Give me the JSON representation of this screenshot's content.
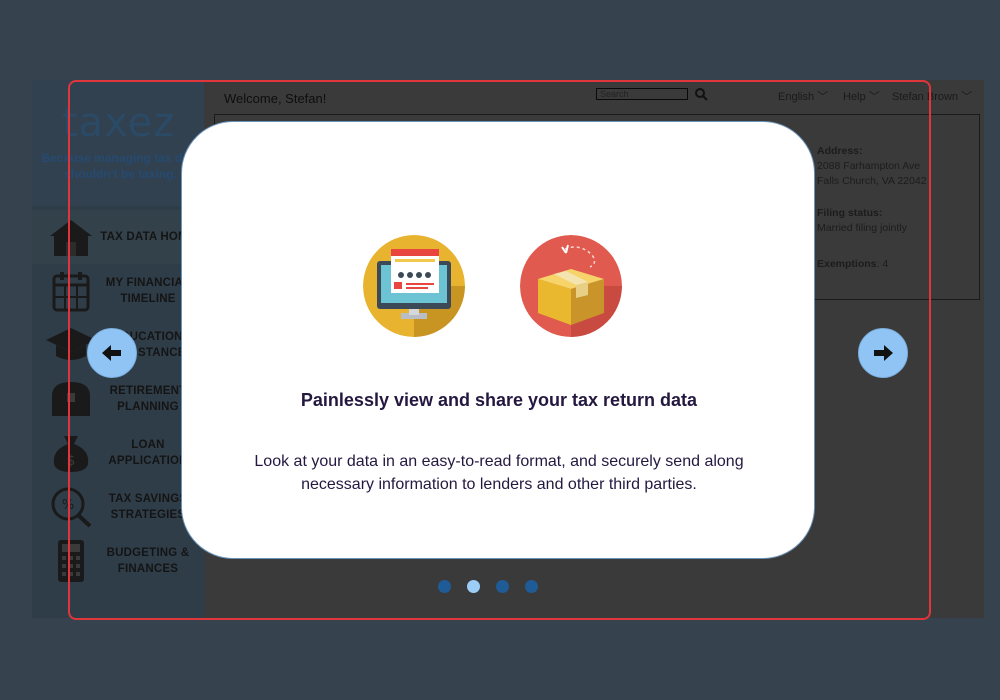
{
  "app": {
    "logo": "taxez",
    "tagline": "Because managing tax data shouldn't be taxing.",
    "welcome": "Welcome, Stefan!",
    "search_placeholder": "Search",
    "menu": {
      "language": "English",
      "help": "Help",
      "user": "Stefan Brown"
    },
    "nav": [
      {
        "label": "TAX DATA HOME",
        "icon": "house-icon"
      },
      {
        "label": "MY FINANCIAL TIMELINE",
        "icon": "calendar-icon"
      },
      {
        "label": "EDUCATION ASSISTANCE",
        "icon": "graduation-cap-icon"
      },
      {
        "label": "RETIREMENT PLANNING",
        "icon": "treasure-chest-icon"
      },
      {
        "label": "LOAN APPLICATION",
        "icon": "money-bag-icon"
      },
      {
        "label": "TAX SAVINGS STRATEGIES",
        "icon": "percent-magnifier-icon"
      },
      {
        "label": "BUDGETING & FINANCES",
        "icon": "calculator-icon"
      }
    ],
    "profile": {
      "address_label": "Address:",
      "address_line1": "2088 Farhampton Ave",
      "address_line2": "Falls Church, VA 22042",
      "filing_label": "Filing status:",
      "filing_value": "Married filing jointly",
      "exemptions_label": "Exemptions",
      "exemptions_value": ": 4"
    }
  },
  "modal": {
    "title": "Painlessly view and share your tax return data",
    "description": "Look at your data in an easy-to-read format, and securely send along necessary information to lenders and other third parties.",
    "icons": [
      "computer-screen-icon",
      "package-box-icon"
    ],
    "current_slide": 2,
    "total_slides": 4
  },
  "colors": {
    "overlay": "#36434e",
    "frame": "#e0353a",
    "arrow_button": "#8fc4f5",
    "dot": "#1f5b96",
    "dot_active": "#9bcdf7",
    "title_text": "#241840"
  }
}
